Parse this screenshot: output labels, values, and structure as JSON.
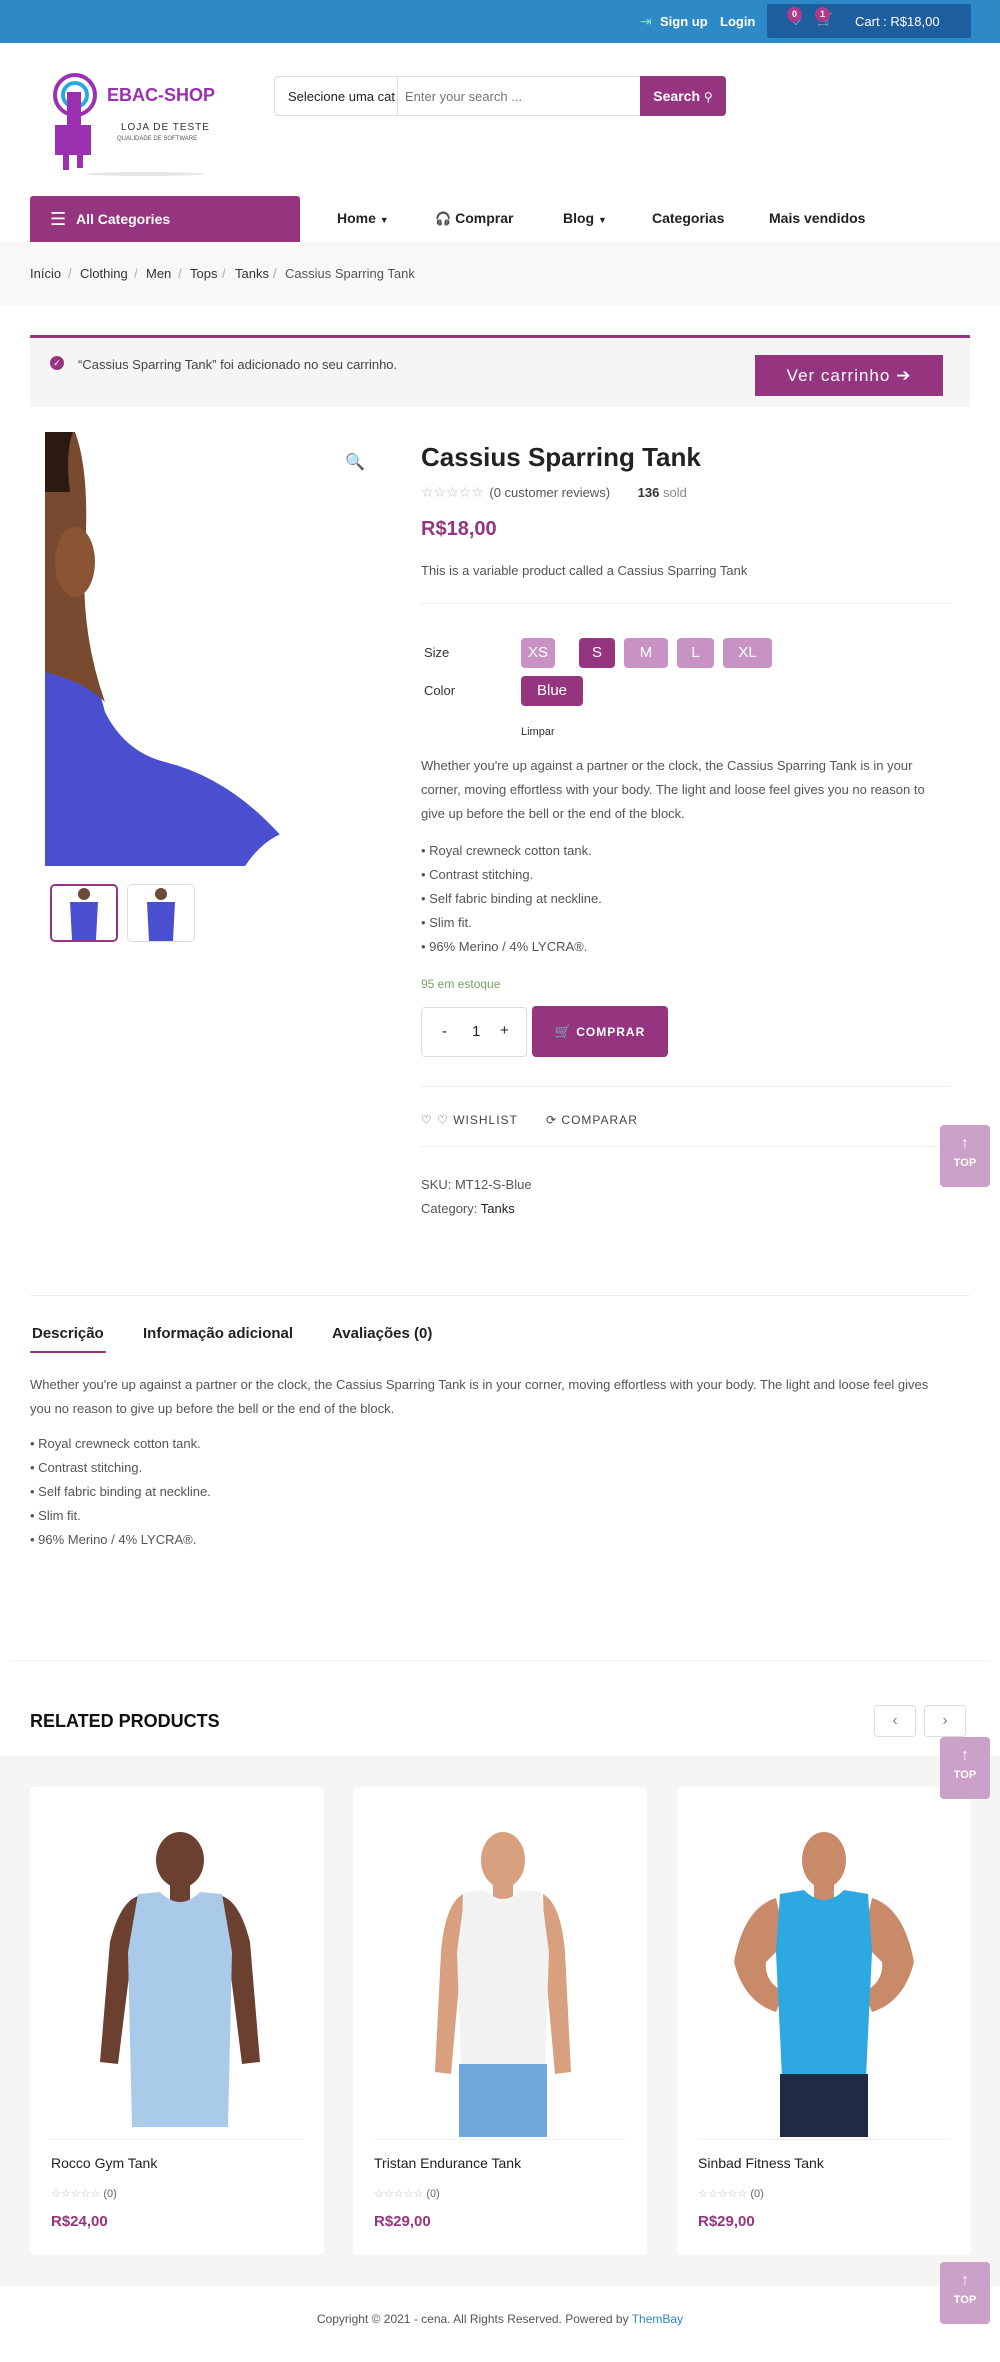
{
  "topbar": {
    "signup": "Sign up",
    "login": "Login",
    "wishlist_count": "0",
    "cart_count": "1",
    "cart_label": "Cart : R$18,00"
  },
  "header": {
    "logo_title": "EBAC-SHOP",
    "logo_sub1": "LOJA DE TESTE",
    "logo_sub2": "QUALIDADE DE SOFTWARE",
    "category_select": "Selecione uma cat",
    "search_placeholder": "Enter your search ...",
    "search_button": "Search"
  },
  "nav": {
    "all_categories": "All Categories",
    "items": [
      "Home",
      "Comprar",
      "Blog",
      "Categorias",
      "Mais vendidos"
    ]
  },
  "breadcrumb": [
    "Início",
    "Clothing",
    "Men",
    "Tops",
    "Tanks",
    "Cassius Sparring Tank"
  ],
  "notice": {
    "text": "“Cassius Sparring Tank” foi adicionado no seu carrinho.",
    "button": "Ver carrinho"
  },
  "product": {
    "title": "Cassius Sparring Tank",
    "reviews": "(0 customer reviews)",
    "sold_count": "136",
    "sold_label": "sold",
    "price": "R$18,00",
    "short_desc": "This is a variable product called a Cassius Sparring Tank",
    "size_label": "Size",
    "sizes": [
      "XS",
      "S",
      "M",
      "L",
      "XL"
    ],
    "selected_size": "S",
    "color_label": "Color",
    "color": "Blue",
    "clear": "Limpar",
    "description": "Whether you're up against a partner or the clock, the Cassius Sparring Tank is in your corner, moving effortless with your body. The light and loose feel gives you no reason to give up before the bell or the end of the block.",
    "desc_lines": [
      "Whether you're up against a partner or the clock, the Cassius Sparring Tank is in your",
      "corner, moving effortless with your body. The light and loose feel gives you no reason to",
      "give up before the bell or the end of the block."
    ],
    "features": [
      "• Royal crewneck cotton tank.",
      "• Contrast stitching.",
      "• Self fabric binding at neckline.",
      "• Slim fit.",
      "• 96% Merino / 4% LYCRA®."
    ],
    "stock": "95 em estoque",
    "qty_minus": "-",
    "qty": "1",
    "qty_plus": "+",
    "buy": "COMPRAR",
    "wishlist": "WISHLIST",
    "compare": "COMPARAR",
    "sku_label": "SKU:",
    "sku": "MT12-S-Blue",
    "category_label": "Category:",
    "category": "Tanks"
  },
  "tabs": {
    "items": [
      "Descrição",
      "Informação adicional",
      "Avaliações (0)"
    ],
    "desc_lines": [
      "Whether you're up against a partner or the clock, the Cassius Sparring Tank is in your corner, moving effortless with your body. The light and loose feel gives",
      "you no reason to give up before the bell or the end of the block."
    ]
  },
  "top_button": "TOP",
  "related": {
    "title": "RELATED PRODUCTS",
    "products": [
      {
        "name": "Rocco Gym Tank",
        "reviews": "(0)",
        "price": "R$24,00",
        "shirt_color": "#a9cbe9"
      },
      {
        "name": "Tristan Endurance Tank",
        "reviews": "(0)",
        "price": "R$29,00",
        "shirt_color": "#f2f2f2"
      },
      {
        "name": "Sinbad Fitness Tank",
        "reviews": "(0)",
        "price": "R$29,00",
        "shirt_color": "#2ea8e0"
      }
    ]
  },
  "footer": {
    "copyright": "Copyright © 2021 - cena. All Rights Reserved. Powered by",
    "powered": "ThemBay"
  },
  "colors": {
    "brand": "#96357f",
    "topbar": "#2e8ac7",
    "stock": "#77a464"
  }
}
